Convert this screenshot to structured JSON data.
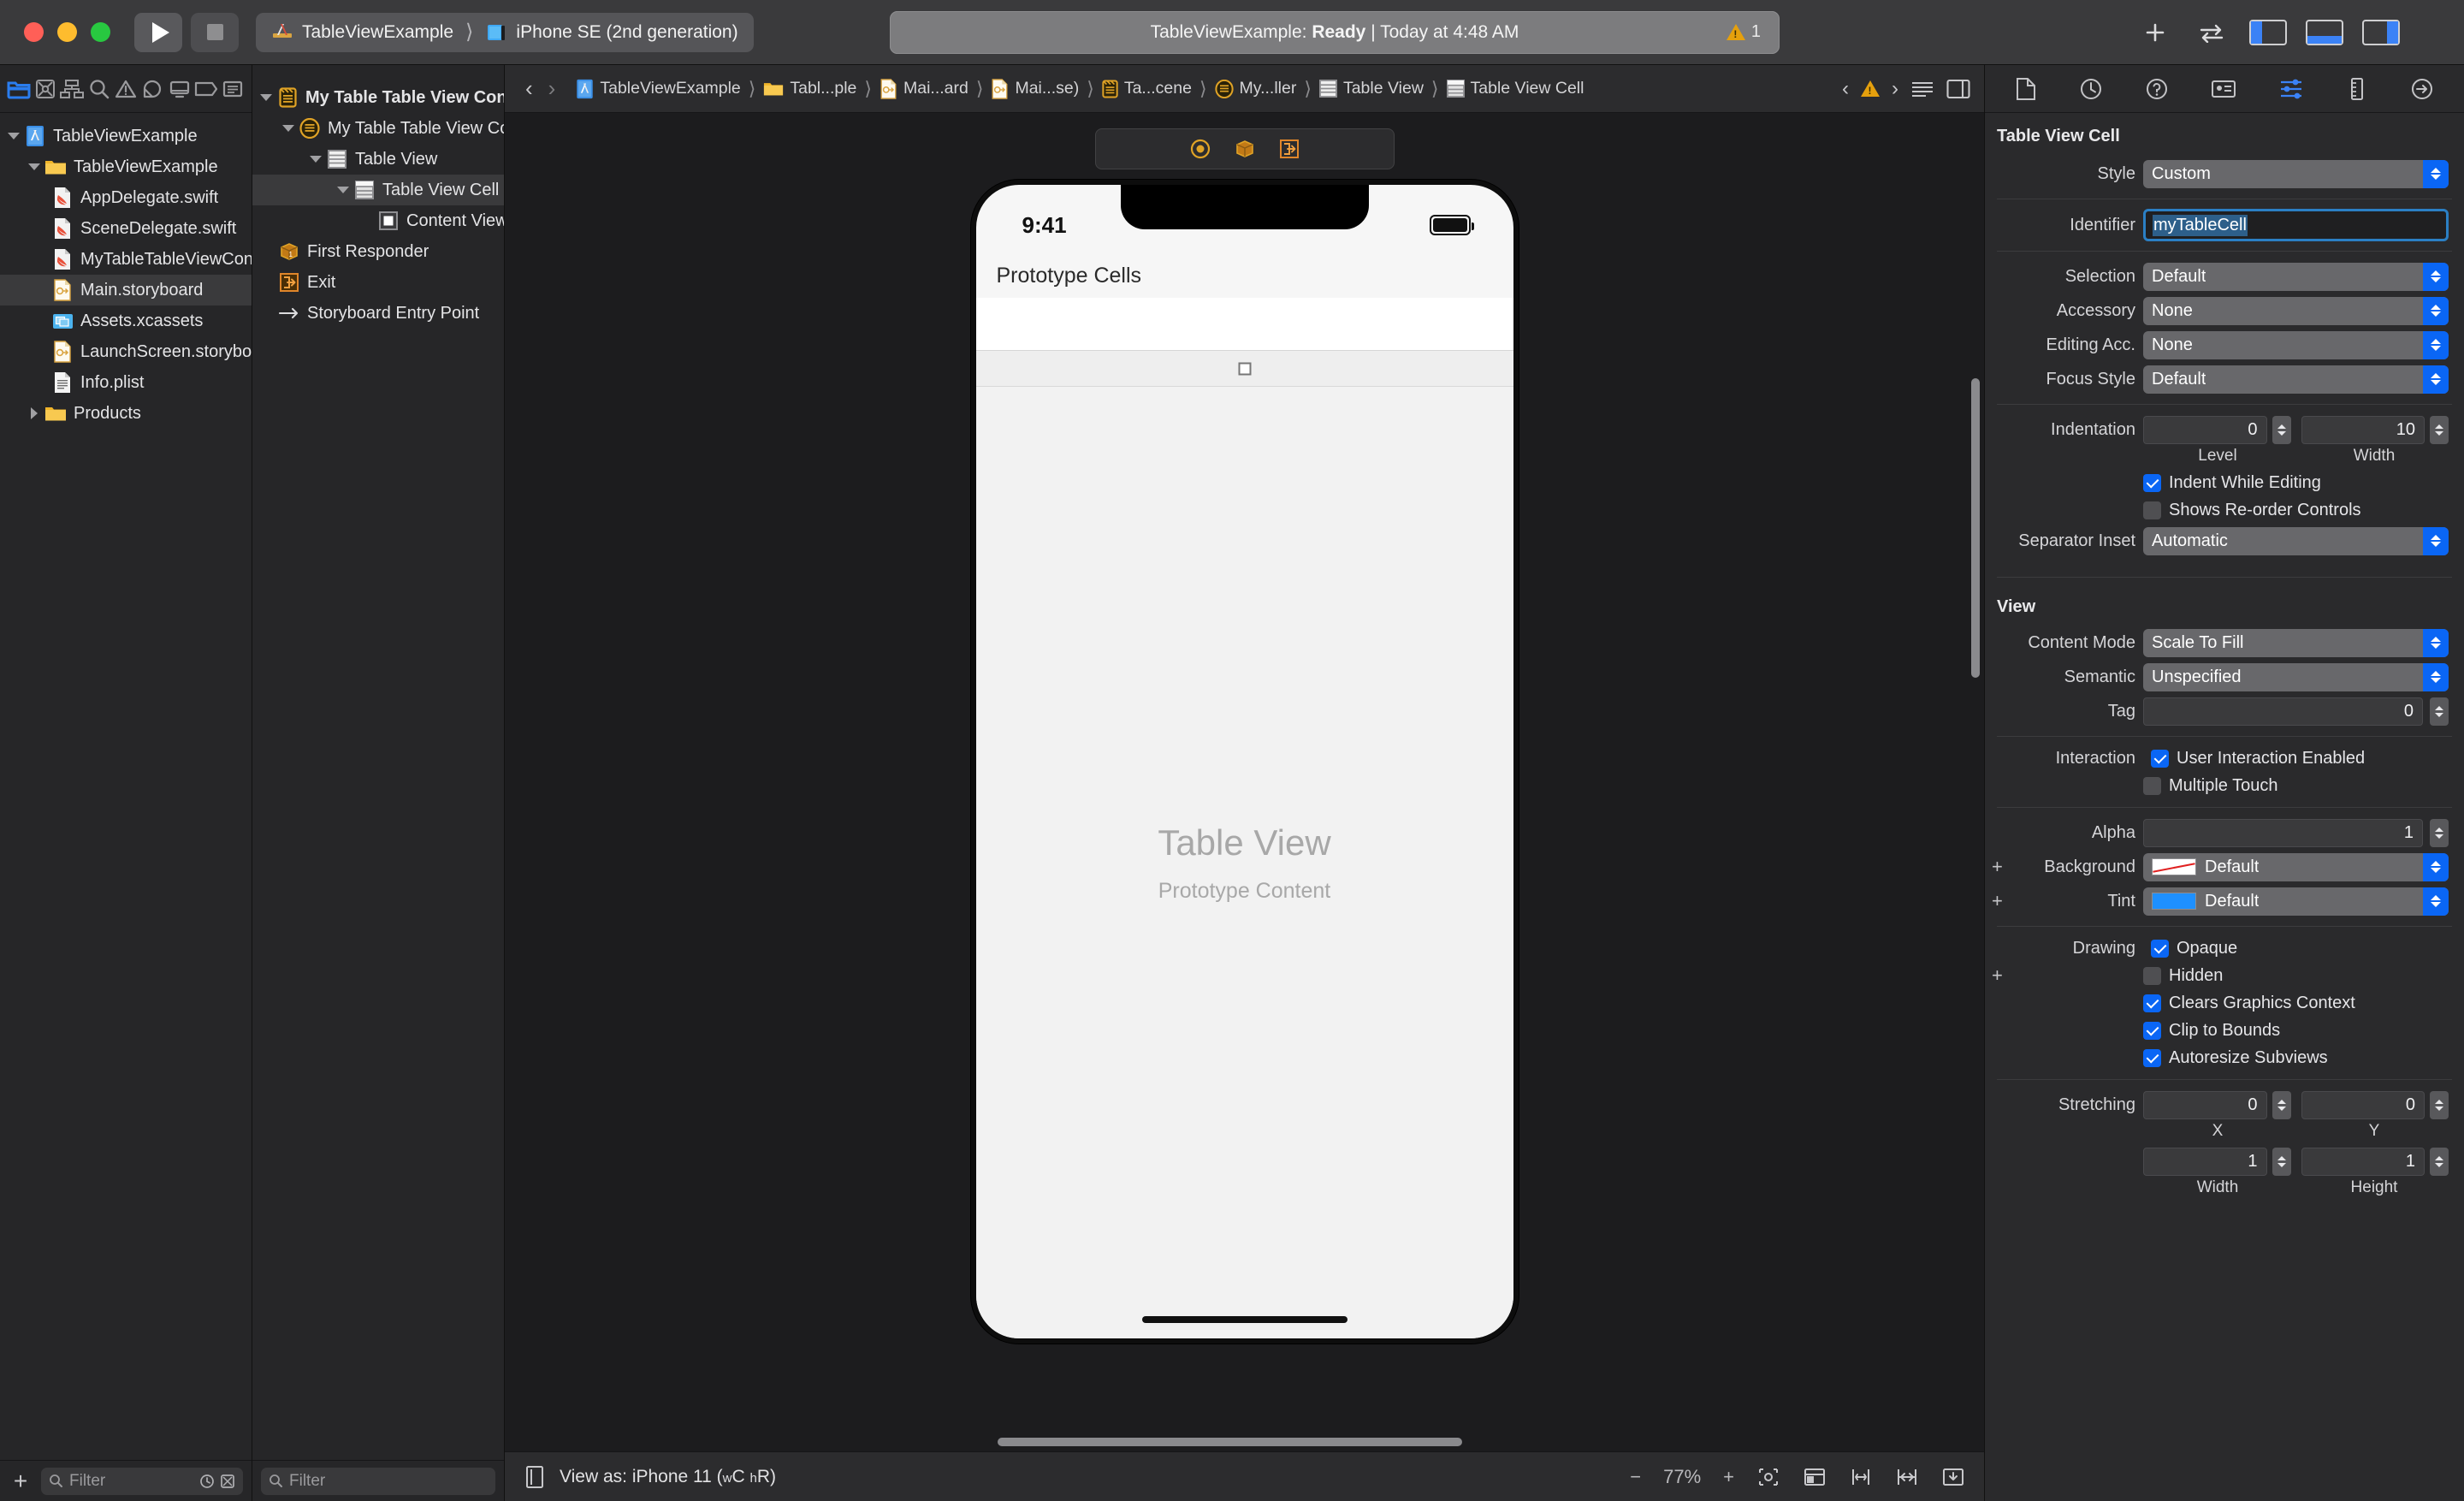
{
  "toolbar": {
    "run_button": "run",
    "stop_button": "stop",
    "scheme_name": "TableViewExample",
    "destination_name": "iPhone SE (2nd generation)",
    "status_prefix": "TableViewExample: ",
    "status_state": "Ready",
    "status_suffix": " | Today at 4:48 AM",
    "warning_count": "1",
    "add_button": "+",
    "toggle_button": "⇄"
  },
  "navigator": {
    "tabs": [
      {
        "name": "project-navigator",
        "icon": "folder-icon",
        "selected": true
      },
      {
        "name": "source-control-navigator",
        "icon": "source-control-icon",
        "selected": false
      },
      {
        "name": "symbol-navigator",
        "icon": "hierarchy-icon",
        "selected": false
      },
      {
        "name": "find-navigator",
        "icon": "search-icon",
        "selected": false
      },
      {
        "name": "issue-navigator",
        "icon": "warning-icon",
        "selected": false
      },
      {
        "name": "test-navigator",
        "icon": "test-icon",
        "selected": false
      },
      {
        "name": "debug-navigator",
        "icon": "debug-icon",
        "selected": false
      },
      {
        "name": "breakpoint-navigator",
        "icon": "breakpoint-icon",
        "selected": false
      }
    ],
    "items": [
      {
        "label": "TableViewExample",
        "icon": "xcode-project-icon",
        "depth": 0,
        "twisty": "down",
        "selected": false
      },
      {
        "label": "TableViewExample",
        "icon": "folder-yellow-icon",
        "depth": 1,
        "twisty": "down",
        "selected": false
      },
      {
        "label": "AppDelegate.swift",
        "icon": "swift-file-icon",
        "depth": 2,
        "twisty": "none",
        "selected": false
      },
      {
        "label": "SceneDelegate.swift",
        "icon": "swift-file-icon",
        "depth": 2,
        "twisty": "none",
        "selected": false
      },
      {
        "label": "MyTableTableViewController.swift",
        "icon": "swift-file-icon",
        "depth": 2,
        "twisty": "none",
        "selected": false
      },
      {
        "label": "Main.storyboard",
        "icon": "storyboard-file-icon",
        "depth": 2,
        "twisty": "none",
        "selected": true
      },
      {
        "label": "Assets.xcassets",
        "icon": "assets-icon",
        "depth": 2,
        "twisty": "none",
        "selected": false
      },
      {
        "label": "LaunchScreen.storyboard",
        "icon": "storyboard-file-icon",
        "depth": 2,
        "twisty": "none",
        "selected": false
      },
      {
        "label": "Info.plist",
        "icon": "plist-file-icon",
        "depth": 2,
        "twisty": "none",
        "selected": false
      },
      {
        "label": "Products",
        "icon": "folder-yellow-icon",
        "depth": 1,
        "twisty": "right",
        "selected": false
      }
    ],
    "filter_placeholder": "Filter",
    "add_label": "+"
  },
  "outline": {
    "items": [
      {
        "label": "My Table Table View Controller Scene",
        "icon": "scene-icon",
        "depth": 0,
        "twisty": "down",
        "selected": false,
        "bold": true
      },
      {
        "label": "My Table Table View Controller",
        "icon": "view-controller-icon",
        "depth": 1,
        "twisty": "down",
        "selected": false,
        "bold": false
      },
      {
        "label": "Table View",
        "icon": "table-view-icon",
        "depth": 2,
        "twisty": "down",
        "selected": false,
        "bold": false
      },
      {
        "label": "Table View Cell",
        "icon": "table-view-cell-icon",
        "depth": 3,
        "twisty": "down",
        "selected": true,
        "bold": false
      },
      {
        "label": "Content View",
        "icon": "content-view-icon",
        "depth": 4,
        "twisty": "none",
        "selected": false,
        "bold": false
      },
      {
        "label": "First Responder",
        "icon": "first-responder-icon",
        "depth": 1,
        "twisty": "none",
        "selected": false,
        "bold": false
      },
      {
        "label": "Exit",
        "icon": "exit-icon",
        "depth": 1,
        "twisty": "none",
        "selected": false,
        "bold": false
      },
      {
        "label": "Storyboard Entry Point",
        "icon": "entry-point-arrow-icon",
        "depth": 1,
        "twisty": "none",
        "selected": false,
        "bold": false
      }
    ],
    "filter_placeholder": "Filter"
  },
  "jumpbar": {
    "items": [
      {
        "label": "TableViewExample",
        "icon": "xcode-project-icon"
      },
      {
        "label": "Tabl...ple",
        "icon": "folder-yellow-icon"
      },
      {
        "label": "Mai...ard",
        "icon": "storyboard-file-icon"
      },
      {
        "label": "Mai...se)",
        "icon": "storyboard-file-icon"
      },
      {
        "label": "Ta...cene",
        "icon": "scene-icon"
      },
      {
        "label": "My...ller",
        "icon": "view-controller-icon"
      },
      {
        "label": "Table View",
        "icon": "table-view-icon"
      },
      {
        "label": "Table View Cell",
        "icon": "table-view-cell-icon"
      }
    ],
    "back_label": "‹",
    "forward_label": "›",
    "issue_count": "1"
  },
  "canvas": {
    "device": {
      "time": "9:41",
      "prototype_cells_label": "Prototype Cells",
      "table_view_title": "Table View",
      "table_view_subtitle": "Prototype Content"
    },
    "bottom": {
      "view_as_label": "View as: iPhone 11 (",
      "view_as_w": "w",
      "view_as_c": "C",
      "view_as_h": "h",
      "view_as_r": "R",
      "view_as_close": ")",
      "zoom_out": "−",
      "zoom_level": "77%",
      "zoom_in": "+"
    }
  },
  "inspector": {
    "tabs": [
      {
        "name": "file-inspector",
        "icon": "document-icon"
      },
      {
        "name": "history-inspector",
        "icon": "clock-icon"
      },
      {
        "name": "quick-help-inspector",
        "icon": "question-icon"
      },
      {
        "name": "identity-inspector",
        "icon": "id-card-icon"
      },
      {
        "name": "attributes-inspector",
        "icon": "slider-icon",
        "selected": true
      },
      {
        "name": "size-inspector",
        "icon": "ruler-icon"
      },
      {
        "name": "connections-inspector",
        "icon": "arrow-circle-icon"
      }
    ],
    "title": "Table View Cell",
    "cell_section": {
      "style_label": "Style",
      "style_value": "Custom",
      "identifier_label": "Identifier",
      "identifier_value": "myTableCell",
      "selection_label": "Selection",
      "selection_value": "Default",
      "accessory_label": "Accessory",
      "accessory_value": "None",
      "editing_acc_label": "Editing Acc.",
      "editing_acc_value": "None",
      "focus_style_label": "Focus Style",
      "focus_style_value": "Default",
      "indentation_label": "Indentation",
      "indentation_level": "0",
      "indentation_level_sub": "Level",
      "indentation_width": "10",
      "indentation_width_sub": "Width",
      "indent_while_editing_label": "Indent While Editing",
      "indent_while_editing_checked": true,
      "shows_reorder_label": "Shows Re-order Controls",
      "shows_reorder_checked": false,
      "separator_inset_label": "Separator Inset",
      "separator_inset_value": "Automatic"
    },
    "view_section": {
      "heading": "View",
      "content_mode_label": "Content Mode",
      "content_mode_value": "Scale To Fill",
      "semantic_label": "Semantic",
      "semantic_value": "Unspecified",
      "tag_label": "Tag",
      "tag_value": "0",
      "interaction_label": "Interaction",
      "user_interaction_label": "User Interaction Enabled",
      "user_interaction_checked": true,
      "multiple_touch_label": "Multiple Touch",
      "multiple_touch_checked": false,
      "alpha_label": "Alpha",
      "alpha_value": "1",
      "background_label": "Background",
      "background_value": "Default",
      "tint_label": "Tint",
      "tint_value": "Default",
      "drawing_label": "Drawing",
      "opaque_label": "Opaque",
      "opaque_checked": true,
      "hidden_label": "Hidden",
      "hidden_checked": false,
      "clears_graphics_label": "Clears Graphics Context",
      "clears_graphics_checked": true,
      "clip_to_bounds_label": "Clip to Bounds",
      "clip_to_bounds_checked": true,
      "autoresize_label": "Autoresize Subviews",
      "autoresize_checked": true,
      "stretching_label": "Stretching",
      "stretch_x": "0",
      "stretch_x_sub": "X",
      "stretch_y": "0",
      "stretch_y_sub": "Y",
      "stretch_w": "1",
      "stretch_w_sub": "Width",
      "stretch_h": "1",
      "stretch_h_sub": "Height"
    }
  },
  "colors": {
    "accent_blue": "#0a66f5",
    "warning_amber": "#e5a00d",
    "selection_blue": "#2d5f8a",
    "tint_default": "#1e90ff"
  }
}
